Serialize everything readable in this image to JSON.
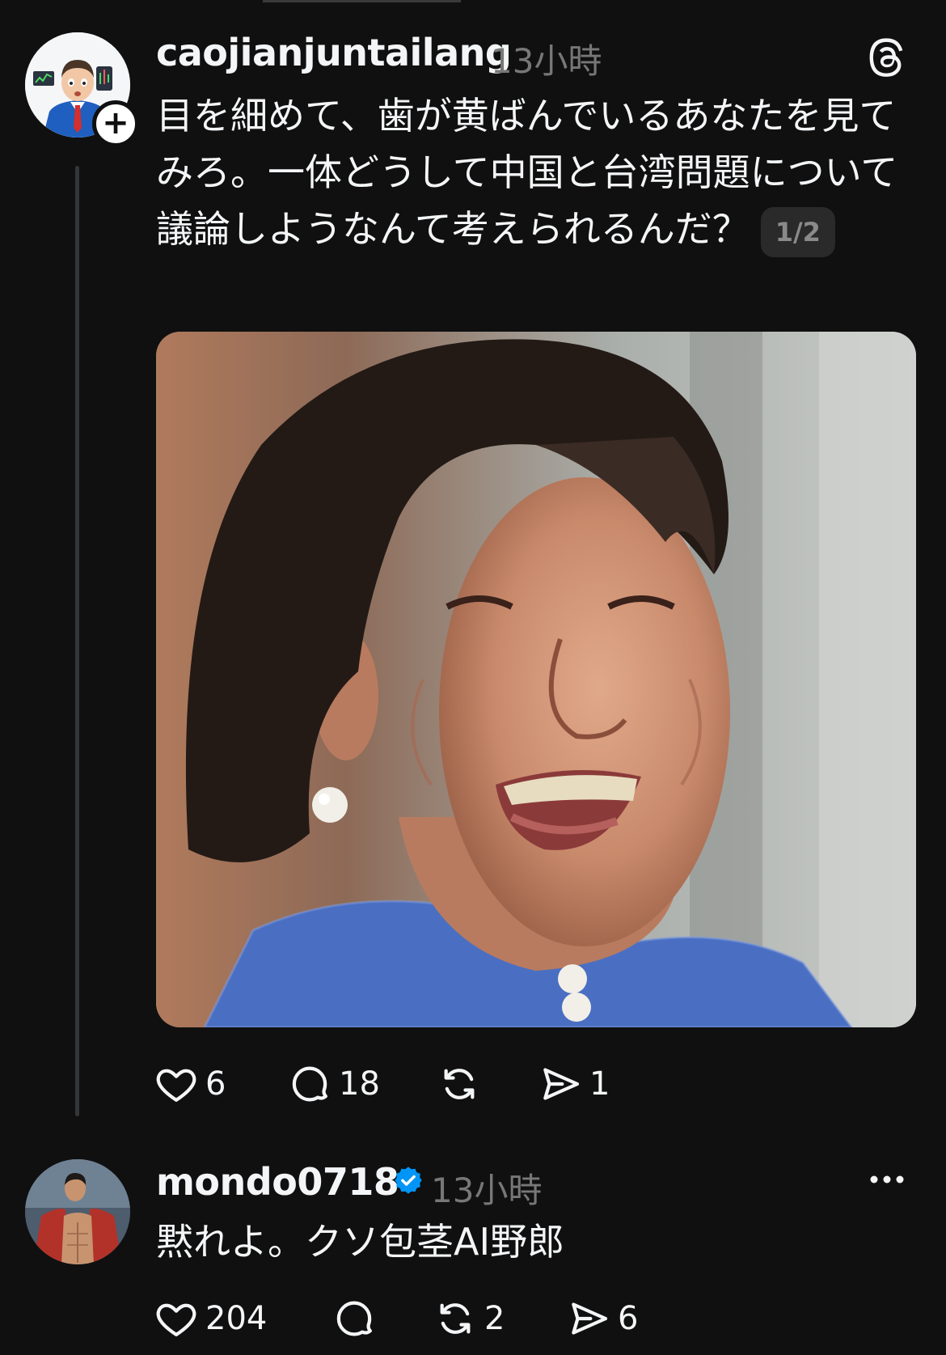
{
  "post": {
    "username": "caojianjuntailang",
    "time": "13小時",
    "text": "目を細めて、歯が黄ばんでいるあなたを見てみろ。一体どうして中国と台湾問題について議論しようなんて考えられるんだ？",
    "page_indicator": "1/2",
    "follow_symbol": "+",
    "app_icon": "threads-icon",
    "image": "photo of a smiling woman with short dark hair and pearl earring",
    "actions": {
      "likes": "6",
      "replies": "18",
      "reposts": "",
      "shares": "1"
    }
  },
  "reply": {
    "username": "mondo0718",
    "verified": true,
    "time": "13小時",
    "text": "黙れよ。クソ包茎AI野郎",
    "actions": {
      "likes": "204",
      "replies": "",
      "reposts": "2",
      "shares": "6"
    }
  },
  "colors": {
    "background": "#101010",
    "text": "#f3f5f7",
    "muted": "#777777",
    "verified": "#0095f6"
  }
}
